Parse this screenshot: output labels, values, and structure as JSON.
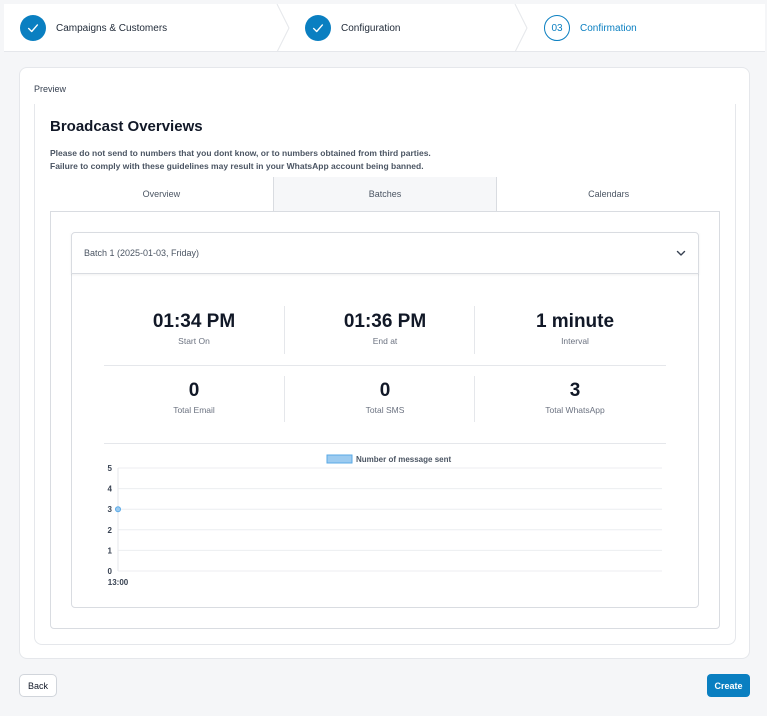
{
  "stepper": {
    "steps": [
      {
        "label": "Campaigns & Customers",
        "state": "done"
      },
      {
        "label": "Configuration",
        "state": "done"
      },
      {
        "label": "Confirmation",
        "state": "current",
        "number": "03"
      }
    ]
  },
  "preview_label": "Preview",
  "title": "Broadcast Overviews",
  "warning": {
    "line1": "Please do not send to numbers that you dont know, or to numbers obtained from third parties.",
    "line2": "Failure to comply with these guidelines may result in your WhatsApp account being banned."
  },
  "tabs": [
    {
      "label": "Overview",
      "active": false
    },
    {
      "label": "Batches",
      "active": true
    },
    {
      "label": "Calendars",
      "active": false
    }
  ],
  "batch": {
    "title": "Batch 1 (2025-01-03, Friday)",
    "stats_row1": [
      {
        "value": "01:34 PM",
        "label": "Start On"
      },
      {
        "value": "01:36 PM",
        "label": "End at"
      },
      {
        "value": "1 minute",
        "label": "Interval"
      }
    ],
    "stats_row2": [
      {
        "value": "0",
        "label": "Total Email"
      },
      {
        "value": "0",
        "label": "Total SMS"
      },
      {
        "value": "3",
        "label": "Total WhatsApp"
      }
    ]
  },
  "chart_data": {
    "type": "line",
    "series": [
      {
        "name": "Number of message sent",
        "x": [
          "13:00"
        ],
        "values": [
          3
        ]
      }
    ],
    "x": [
      "13:00"
    ],
    "yticks": [
      0,
      1,
      2,
      3,
      4,
      5
    ],
    "ylim": [
      0,
      5
    ],
    "legend": "top-center",
    "colors": {
      "series": "#9ccbf0",
      "series_border": "#5aa9e6"
    }
  },
  "buttons": {
    "back": "Back",
    "create": "Create"
  },
  "colors": {
    "accent": "#0a7fc1"
  }
}
